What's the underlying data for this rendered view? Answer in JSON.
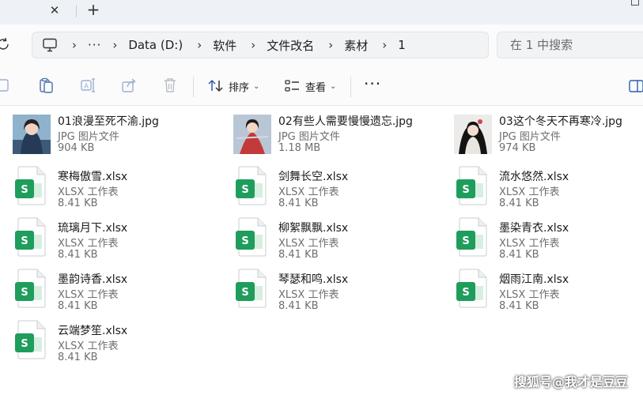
{
  "tabbar": {
    "close_glyph": "✕",
    "new_tab_glyph": "+"
  },
  "address": {
    "more_glyph": "···",
    "crumbs": [
      "Data (D:)",
      "软件",
      "文件改名",
      "素材",
      "1"
    ]
  },
  "search": {
    "placeholder": "在 1 中搜索"
  },
  "toolbar": {
    "sort_label": "排序",
    "view_label": "查看",
    "more_glyph": "···",
    "icons": [
      "copy-icon",
      "paste-icon",
      "rename-icon",
      "share-icon",
      "delete-icon",
      "sort-icon",
      "view-icon",
      "more-icon"
    ]
  },
  "files": [
    {
      "name": "01浪漫至死不渝.jpg",
      "type": "JPG 图片文件",
      "size": "904 KB",
      "kind": "image"
    },
    {
      "name": "02有些人需要慢慢遗忘.jpg",
      "type": "JPG 图片文件",
      "size": "1.18 MB",
      "kind": "image"
    },
    {
      "name": "03这个冬天不再寒冷.jpg",
      "type": "JPG 图片文件",
      "size": "974 KB",
      "kind": "image"
    },
    {
      "name": "寒梅傲雪.xlsx",
      "type": "XLSX 工作表",
      "size": "8.41 KB",
      "kind": "xlsx"
    },
    {
      "name": "剑舞长空.xlsx",
      "type": "XLSX 工作表",
      "size": "8.41 KB",
      "kind": "xlsx"
    },
    {
      "name": "流水悠然.xlsx",
      "type": "XLSX 工作表",
      "size": "8.41 KB",
      "kind": "xlsx"
    },
    {
      "name": "琉璃月下.xlsx",
      "type": "XLSX 工作表",
      "size": "8.41 KB",
      "kind": "xlsx"
    },
    {
      "name": "柳絮飘飘.xlsx",
      "type": "XLSX 工作表",
      "size": "8.41 KB",
      "kind": "xlsx"
    },
    {
      "name": "墨染青衣.xlsx",
      "type": "XLSX 工作表",
      "size": "8.41 KB",
      "kind": "xlsx"
    },
    {
      "name": "墨韵诗香.xlsx",
      "type": "XLSX 工作表",
      "size": "8.41 KB",
      "kind": "xlsx"
    },
    {
      "name": "琴瑟和鸣.xlsx",
      "type": "XLSX 工作表",
      "size": "8.41 KB",
      "kind": "xlsx"
    },
    {
      "name": "烟雨江南.xlsx",
      "type": "XLSX 工作表",
      "size": "8.41 KB",
      "kind": "xlsx"
    },
    {
      "name": "云端梦笙.xlsx",
      "type": "XLSX 工作表",
      "size": "8.41 KB",
      "kind": "xlsx"
    }
  ],
  "xlsx_icon_letter": "S",
  "colors": {
    "xlsx_green": "#1f9d5c",
    "accent_blue": "#2b5cad"
  },
  "watermark": "搜狐号@我才是豆豆"
}
